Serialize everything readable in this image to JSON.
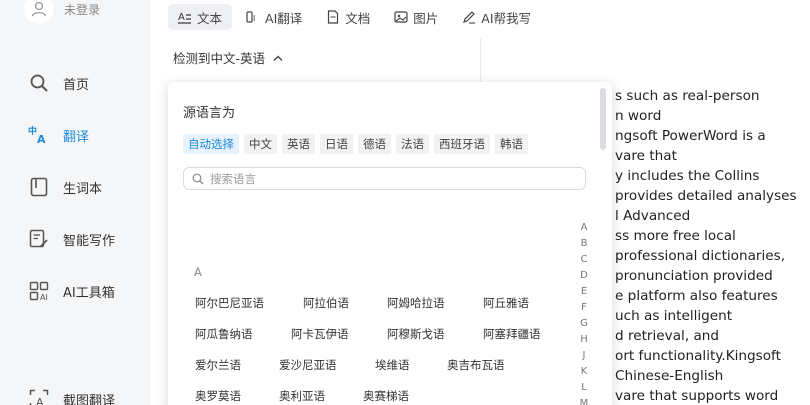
{
  "sidebar": {
    "user_label": "未登录",
    "items": [
      {
        "label": "首页",
        "icon": "search-icon"
      },
      {
        "label": "翻译",
        "icon": "translate-icon"
      },
      {
        "label": "生词本",
        "icon": "bookmark-icon"
      },
      {
        "label": "智能写作",
        "icon": "write-icon"
      },
      {
        "label": "AI工具箱",
        "icon": "ai-toolbox-icon"
      },
      {
        "label": "截图翻译",
        "icon": "screenshot-translate-icon"
      }
    ],
    "active_color": "#1f8bd8"
  },
  "tabs": [
    {
      "label": "文本",
      "icon": "text-icon"
    },
    {
      "label": "AI翻译",
      "icon": "ai-icon"
    },
    {
      "label": "文档",
      "icon": "document-icon"
    },
    {
      "label": "图片",
      "icon": "image-icon"
    },
    {
      "label": "AI帮我写",
      "icon": "pen-icon"
    }
  ],
  "detect_label": "检测到中文-英语",
  "popup": {
    "title": "源语言为",
    "chips": [
      "自动选择",
      "中文",
      "英语",
      "日语",
      "德语",
      "法语",
      "西班牙语",
      "韩语"
    ],
    "search_placeholder": "搜索语言",
    "section_letter": "A",
    "languages": [
      "阿尔巴尼亚语",
      "阿拉伯语",
      "阿姆哈拉语",
      "阿丘雅语",
      "阿瓜鲁纳语",
      "阿卡瓦伊语",
      "阿穆斯戈语",
      "阿塞拜疆语",
      "爱尔兰语",
      "爱沙尼亚语",
      "埃维语",
      "奥吉布瓦语",
      "奥罗莫语",
      "奥利亚语",
      "奥赛梯语"
    ],
    "alphabet": [
      "A",
      "B",
      "C",
      "D",
      "E",
      "F",
      "G",
      "H",
      "J",
      "K",
      "L",
      "M"
    ]
  },
  "translation_lines": [
    "s such as real-person",
    "n word",
    "ngsoft PowerWord is a",
    "vare that",
    "y includes the Collins",
    "provides detailed analyses",
    "l Advanced",
    "ss more free local",
    "professional dictionaries,",
    "pronunciation provided",
    "e platform also features",
    "uch as intelligent",
    "d retrieval, and",
    "ort functionality.Kingsoft",
    "Chinese-English",
    "vare that supports word"
  ]
}
